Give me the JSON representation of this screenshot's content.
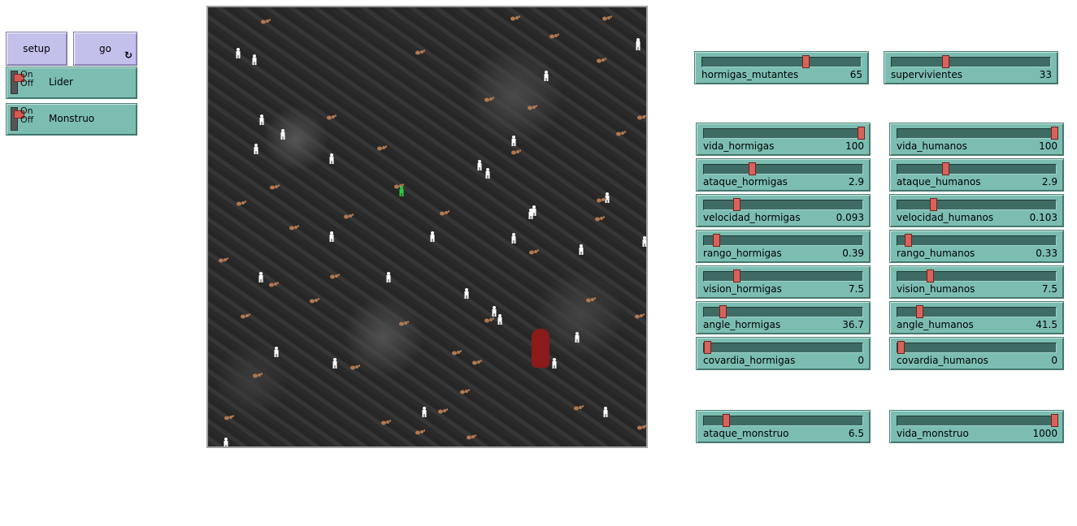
{
  "buttons": {
    "setup_label": "setup",
    "go_label": "go",
    "go_forever_icon": "forever-loop-icon"
  },
  "switches": [
    {
      "on_label": "On",
      "off_label": "Off",
      "label": "Lider",
      "state": "off"
    },
    {
      "on_label": "On",
      "off_label": "Off",
      "label": "Monstruo",
      "state": "off"
    }
  ],
  "sliders": {
    "hormigas_mutantes": {
      "label": "hormigas_mutantes",
      "value": "65",
      "fraction": 0.65
    },
    "supervivientes": {
      "label": "supervivientes",
      "value": "33",
      "fraction": 0.33
    },
    "vida_hormigas": {
      "label": "vida_hormigas",
      "value": "100",
      "fraction": 1.0
    },
    "vida_humanos": {
      "label": "vida_humanos",
      "value": "100",
      "fraction": 1.0
    },
    "ataque_hormigas": {
      "label": "ataque_hormigas",
      "value": "2.9",
      "fraction": 0.29
    },
    "ataque_humanos": {
      "label": "ataque_humanos",
      "value": "2.9",
      "fraction": 0.29
    },
    "velocidad_hormigas": {
      "label": "velocidad_hormigas",
      "value": "0.093",
      "fraction": 0.19
    },
    "velocidad_humanos": {
      "label": "velocidad_humanos",
      "value": "0.103",
      "fraction": 0.21
    },
    "rango_hormigas": {
      "label": "rango_hormigas",
      "value": "0.39",
      "fraction": 0.06
    },
    "rango_humanos": {
      "label": "rango_humanos",
      "value": "0.33",
      "fraction": 0.05
    },
    "vision_hormigas": {
      "label": "vision_hormigas",
      "value": "7.5",
      "fraction": 0.19
    },
    "vision_humanos": {
      "label": "vision_humanos",
      "value": "7.5",
      "fraction": 0.19
    },
    "angle_hormigas": {
      "label": "angle_hormigas",
      "value": "36.7",
      "fraction": 0.1
    },
    "angle_humanos": {
      "label": "angle_humanos",
      "value": "41.5",
      "fraction": 0.12
    },
    "covardia_hormigas": {
      "label": "covardia_hormigas",
      "value": "0",
      "fraction": 0.0
    },
    "covardia_humanos": {
      "label": "covardia_humanos",
      "value": "0",
      "fraction": 0.0
    },
    "ataque_monstruo": {
      "label": "ataque_monstruo",
      "value": "6.5",
      "fraction": 0.12
    },
    "vida_monstruo": {
      "label": "vida_monstruo",
      "value": "1000",
      "fraction": 1.0
    }
  },
  "world": {
    "human_icon": "person-icon",
    "ant_icon": "ant-icon",
    "leader_icon": "leader-person-icon",
    "monster_icon": "monster-icon",
    "human_color": "#ffffff",
    "ant_color": "#b07850",
    "leader_color": "#2ecc40",
    "monster_color": "#8b1a1a"
  },
  "colors": {
    "button_bg": "#c4c0ec",
    "widget_bg": "#7cbdb2",
    "slider_thumb": "#d7635c"
  }
}
